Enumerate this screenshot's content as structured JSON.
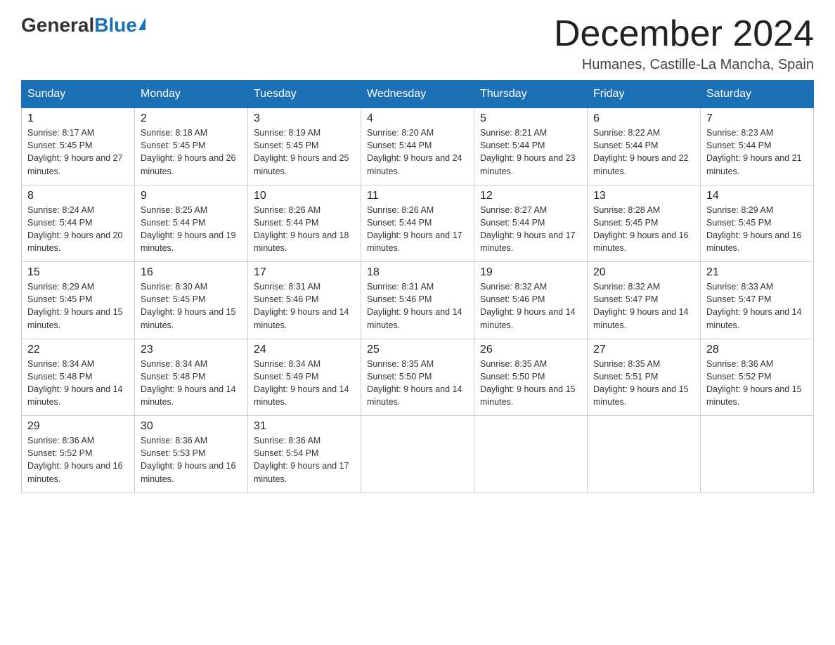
{
  "logo": {
    "general": "General",
    "blue": "Blue"
  },
  "header": {
    "title": "December 2024",
    "location": "Humanes, Castille-La Mancha, Spain"
  },
  "weekdays": [
    "Sunday",
    "Monday",
    "Tuesday",
    "Wednesday",
    "Thursday",
    "Friday",
    "Saturday"
  ],
  "weeks": [
    [
      {
        "day": "1",
        "sunrise": "8:17 AM",
        "sunset": "5:45 PM",
        "daylight": "9 hours and 27 minutes."
      },
      {
        "day": "2",
        "sunrise": "8:18 AM",
        "sunset": "5:45 PM",
        "daylight": "9 hours and 26 minutes."
      },
      {
        "day": "3",
        "sunrise": "8:19 AM",
        "sunset": "5:45 PM",
        "daylight": "9 hours and 25 minutes."
      },
      {
        "day": "4",
        "sunrise": "8:20 AM",
        "sunset": "5:44 PM",
        "daylight": "9 hours and 24 minutes."
      },
      {
        "day": "5",
        "sunrise": "8:21 AM",
        "sunset": "5:44 PM",
        "daylight": "9 hours and 23 minutes."
      },
      {
        "day": "6",
        "sunrise": "8:22 AM",
        "sunset": "5:44 PM",
        "daylight": "9 hours and 22 minutes."
      },
      {
        "day": "7",
        "sunrise": "8:23 AM",
        "sunset": "5:44 PM",
        "daylight": "9 hours and 21 minutes."
      }
    ],
    [
      {
        "day": "8",
        "sunrise": "8:24 AM",
        "sunset": "5:44 PM",
        "daylight": "9 hours and 20 minutes."
      },
      {
        "day": "9",
        "sunrise": "8:25 AM",
        "sunset": "5:44 PM",
        "daylight": "9 hours and 19 minutes."
      },
      {
        "day": "10",
        "sunrise": "8:26 AM",
        "sunset": "5:44 PM",
        "daylight": "9 hours and 18 minutes."
      },
      {
        "day": "11",
        "sunrise": "8:26 AM",
        "sunset": "5:44 PM",
        "daylight": "9 hours and 17 minutes."
      },
      {
        "day": "12",
        "sunrise": "8:27 AM",
        "sunset": "5:44 PM",
        "daylight": "9 hours and 17 minutes."
      },
      {
        "day": "13",
        "sunrise": "8:28 AM",
        "sunset": "5:45 PM",
        "daylight": "9 hours and 16 minutes."
      },
      {
        "day": "14",
        "sunrise": "8:29 AM",
        "sunset": "5:45 PM",
        "daylight": "9 hours and 16 minutes."
      }
    ],
    [
      {
        "day": "15",
        "sunrise": "8:29 AM",
        "sunset": "5:45 PM",
        "daylight": "9 hours and 15 minutes."
      },
      {
        "day": "16",
        "sunrise": "8:30 AM",
        "sunset": "5:45 PM",
        "daylight": "9 hours and 15 minutes."
      },
      {
        "day": "17",
        "sunrise": "8:31 AM",
        "sunset": "5:46 PM",
        "daylight": "9 hours and 14 minutes."
      },
      {
        "day": "18",
        "sunrise": "8:31 AM",
        "sunset": "5:46 PM",
        "daylight": "9 hours and 14 minutes."
      },
      {
        "day": "19",
        "sunrise": "8:32 AM",
        "sunset": "5:46 PM",
        "daylight": "9 hours and 14 minutes."
      },
      {
        "day": "20",
        "sunrise": "8:32 AM",
        "sunset": "5:47 PM",
        "daylight": "9 hours and 14 minutes."
      },
      {
        "day": "21",
        "sunrise": "8:33 AM",
        "sunset": "5:47 PM",
        "daylight": "9 hours and 14 minutes."
      }
    ],
    [
      {
        "day": "22",
        "sunrise": "8:34 AM",
        "sunset": "5:48 PM",
        "daylight": "9 hours and 14 minutes."
      },
      {
        "day": "23",
        "sunrise": "8:34 AM",
        "sunset": "5:48 PM",
        "daylight": "9 hours and 14 minutes."
      },
      {
        "day": "24",
        "sunrise": "8:34 AM",
        "sunset": "5:49 PM",
        "daylight": "9 hours and 14 minutes."
      },
      {
        "day": "25",
        "sunrise": "8:35 AM",
        "sunset": "5:50 PM",
        "daylight": "9 hours and 14 minutes."
      },
      {
        "day": "26",
        "sunrise": "8:35 AM",
        "sunset": "5:50 PM",
        "daylight": "9 hours and 15 minutes."
      },
      {
        "day": "27",
        "sunrise": "8:35 AM",
        "sunset": "5:51 PM",
        "daylight": "9 hours and 15 minutes."
      },
      {
        "day": "28",
        "sunrise": "8:36 AM",
        "sunset": "5:52 PM",
        "daylight": "9 hours and 15 minutes."
      }
    ],
    [
      {
        "day": "29",
        "sunrise": "8:36 AM",
        "sunset": "5:52 PM",
        "daylight": "9 hours and 16 minutes."
      },
      {
        "day": "30",
        "sunrise": "8:36 AM",
        "sunset": "5:53 PM",
        "daylight": "9 hours and 16 minutes."
      },
      {
        "day": "31",
        "sunrise": "8:36 AM",
        "sunset": "5:54 PM",
        "daylight": "9 hours and 17 minutes."
      },
      null,
      null,
      null,
      null
    ]
  ]
}
